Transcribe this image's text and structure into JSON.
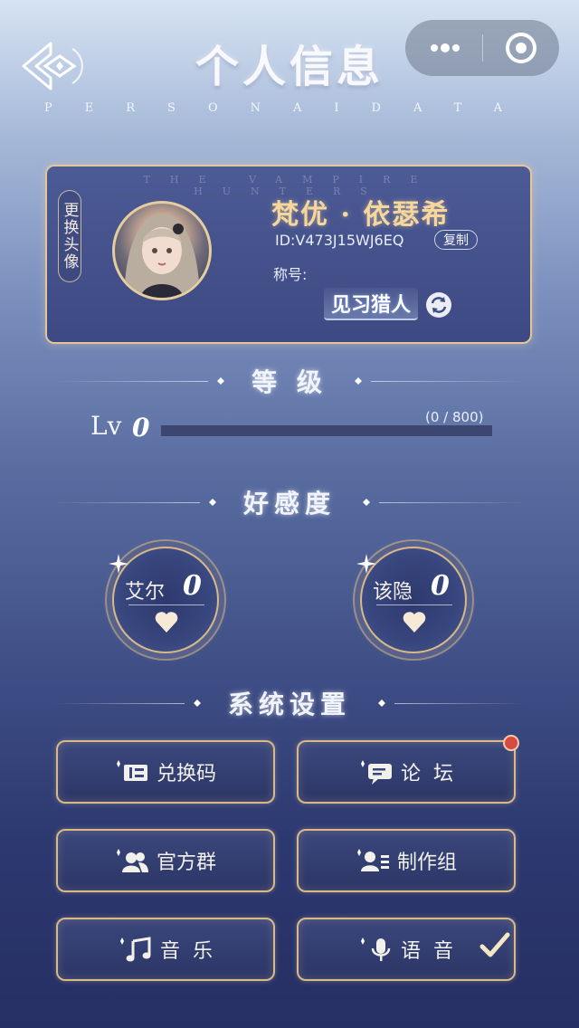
{
  "header": {
    "title": "个人信息",
    "subtitle": "PERSONAIDATA"
  },
  "profile": {
    "watermark": "THE VAMPIRE HUNTERS",
    "change_avatar_label": "更换头像",
    "name": "梵优 · 依瑟希",
    "id": "ID:V473J15WJ6EQ",
    "copy_label": "复制",
    "title_label": "称号:",
    "title_value": "见习猎人"
  },
  "level": {
    "section_title": "等 级",
    "prefix": "Lv",
    "value": "0",
    "progress_text": "(0 / 800)",
    "progress_fraction": 0
  },
  "affection": {
    "section_title": "好感度",
    "characters": [
      {
        "name": "艾尔",
        "score": "0"
      },
      {
        "name": "该隐",
        "score": "0"
      }
    ]
  },
  "settings": {
    "section_title": "系统设置",
    "buttons": [
      {
        "label": "兑换码",
        "icon": "ticket-icon"
      },
      {
        "label": "论  坛",
        "icon": "chat-bubble-icon",
        "has_notification": true
      },
      {
        "label": "官方群",
        "icon": "group-icon"
      },
      {
        "label": "制作组",
        "icon": "user-list-icon"
      },
      {
        "label": "音  乐",
        "icon": "music-note-icon"
      },
      {
        "label": "语  音",
        "icon": "microphone-icon",
        "checked": true
      }
    ]
  },
  "colors": {
    "gold_border": "#d9b987",
    "name_gold": "#f5d79c",
    "notification": "#d84b42"
  }
}
